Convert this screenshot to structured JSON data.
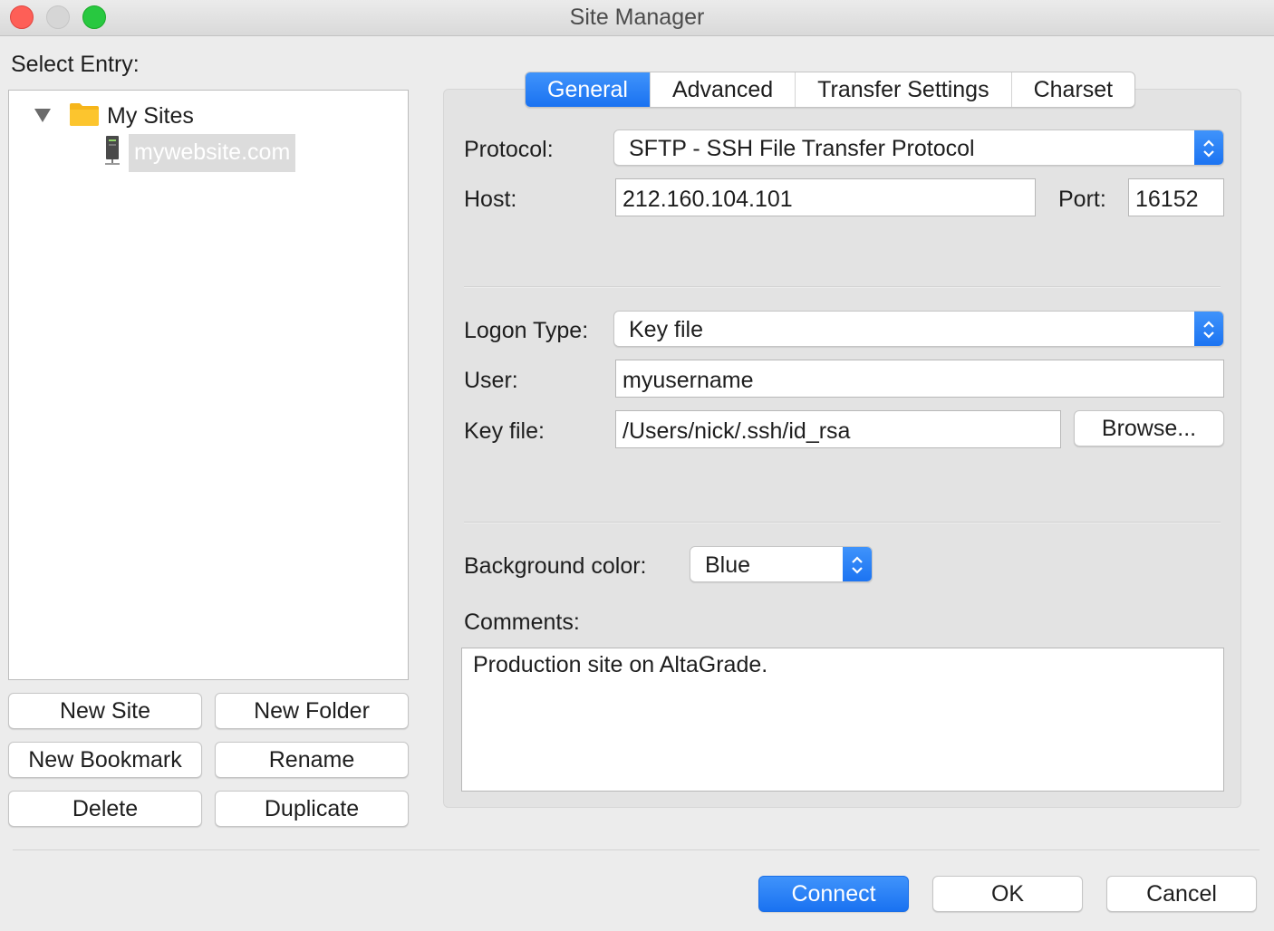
{
  "window": {
    "title": "Site Manager"
  },
  "left": {
    "select_entry_label": "Select Entry:",
    "tree": {
      "root_label": "My Sites",
      "selected_site": "mywebsite.com"
    },
    "buttons": {
      "new_site": "New Site",
      "new_folder": "New Folder",
      "new_bookmark": "New Bookmark",
      "rename": "Rename",
      "delete": "Delete",
      "duplicate": "Duplicate"
    }
  },
  "tabs": [
    {
      "label": "General",
      "active": true
    },
    {
      "label": "Advanced",
      "active": false
    },
    {
      "label": "Transfer Settings",
      "active": false
    },
    {
      "label": "Charset",
      "active": false
    }
  ],
  "general": {
    "protocol_label": "Protocol:",
    "protocol_value": "SFTP - SSH File Transfer Protocol",
    "host_label": "Host:",
    "host_value": "212.160.104.101",
    "port_label": "Port:",
    "port_value": "16152",
    "logon_type_label": "Logon Type:",
    "logon_type_value": "Key file",
    "user_label": "User:",
    "user_value": "myusername",
    "key_file_label": "Key file:",
    "key_file_value": "/Users/nick/.ssh/id_rsa",
    "browse_label": "Browse...",
    "background_color_label": "Background color:",
    "background_color_value": "Blue",
    "comments_label": "Comments:",
    "comments_value": "Production site on AltaGrade."
  },
  "footer": {
    "connect": "Connect",
    "ok": "OK",
    "cancel": "Cancel"
  },
  "colors": {
    "accent": "#1a72f1",
    "window_bg": "#ececec",
    "selection_bg": "#dcdcdc"
  }
}
